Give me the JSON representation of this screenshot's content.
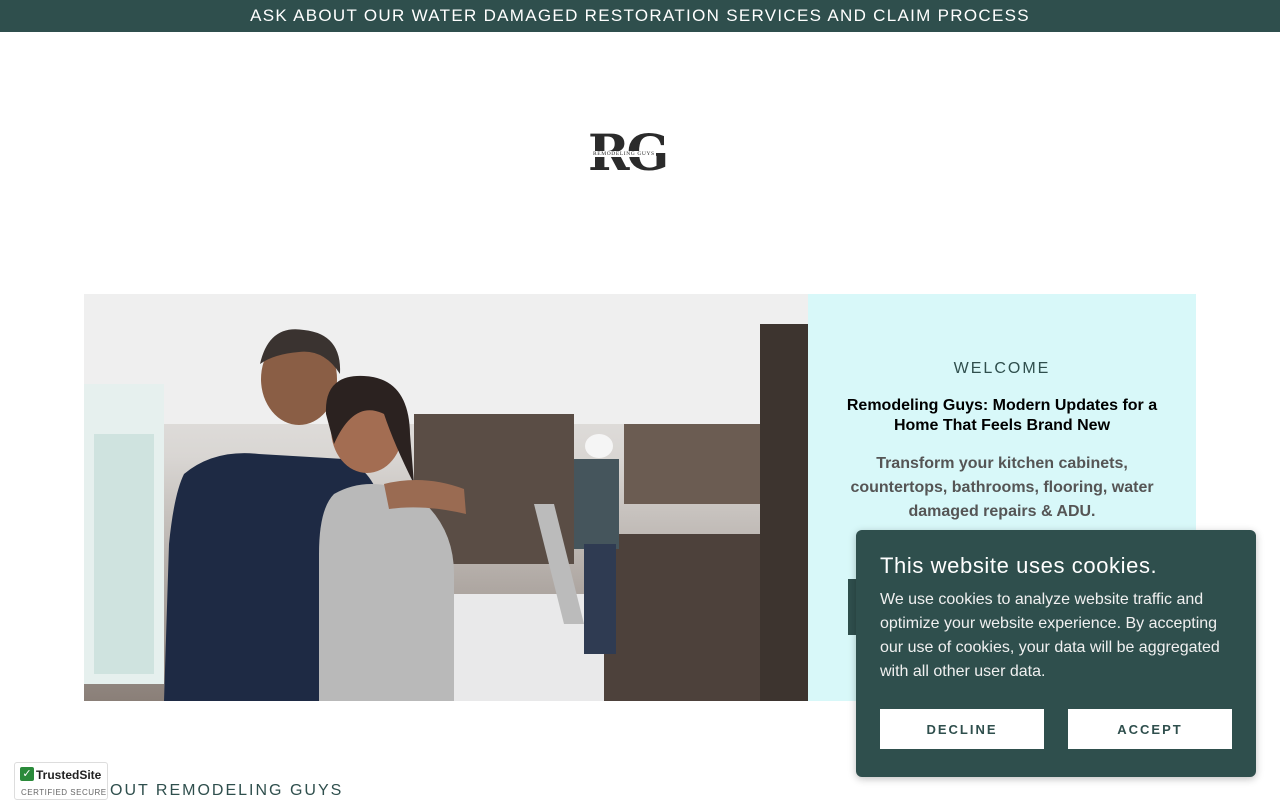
{
  "announcement": "ASK ABOUT OUR WATER DAMAGED RESTORATION SERVICES AND CLAIM PROCESS",
  "logo": {
    "letters": "RG",
    "subtitle": "REMODELING GUYS"
  },
  "hero": {
    "image_icon": "photo-couple-kitchen-remodel"
  },
  "welcome": {
    "title": "WELCOME",
    "heading": "Remodeling Guys: Modern Updates for a Home That Feels Brand New",
    "body": "Transform your kitchen cabinets, countertops, bathrooms, flooring, water damaged repairs & ADU."
  },
  "about": {
    "title": "OUT REMODELING GUYS"
  },
  "trusted_site": {
    "name": "TrustedSite",
    "tagline": "CERTIFIED SECURE"
  },
  "cookie_banner": {
    "title": "This website uses cookies.",
    "text": "We use cookies to analyze website traffic and optimize your website experience. By accepting our use of cookies, your data will be aggregated with all other user data.",
    "decline_label": "DECLINE",
    "accept_label": "ACCEPT"
  },
  "colors": {
    "brand": "#2f4f4d",
    "panel": "#d8f8f9"
  }
}
